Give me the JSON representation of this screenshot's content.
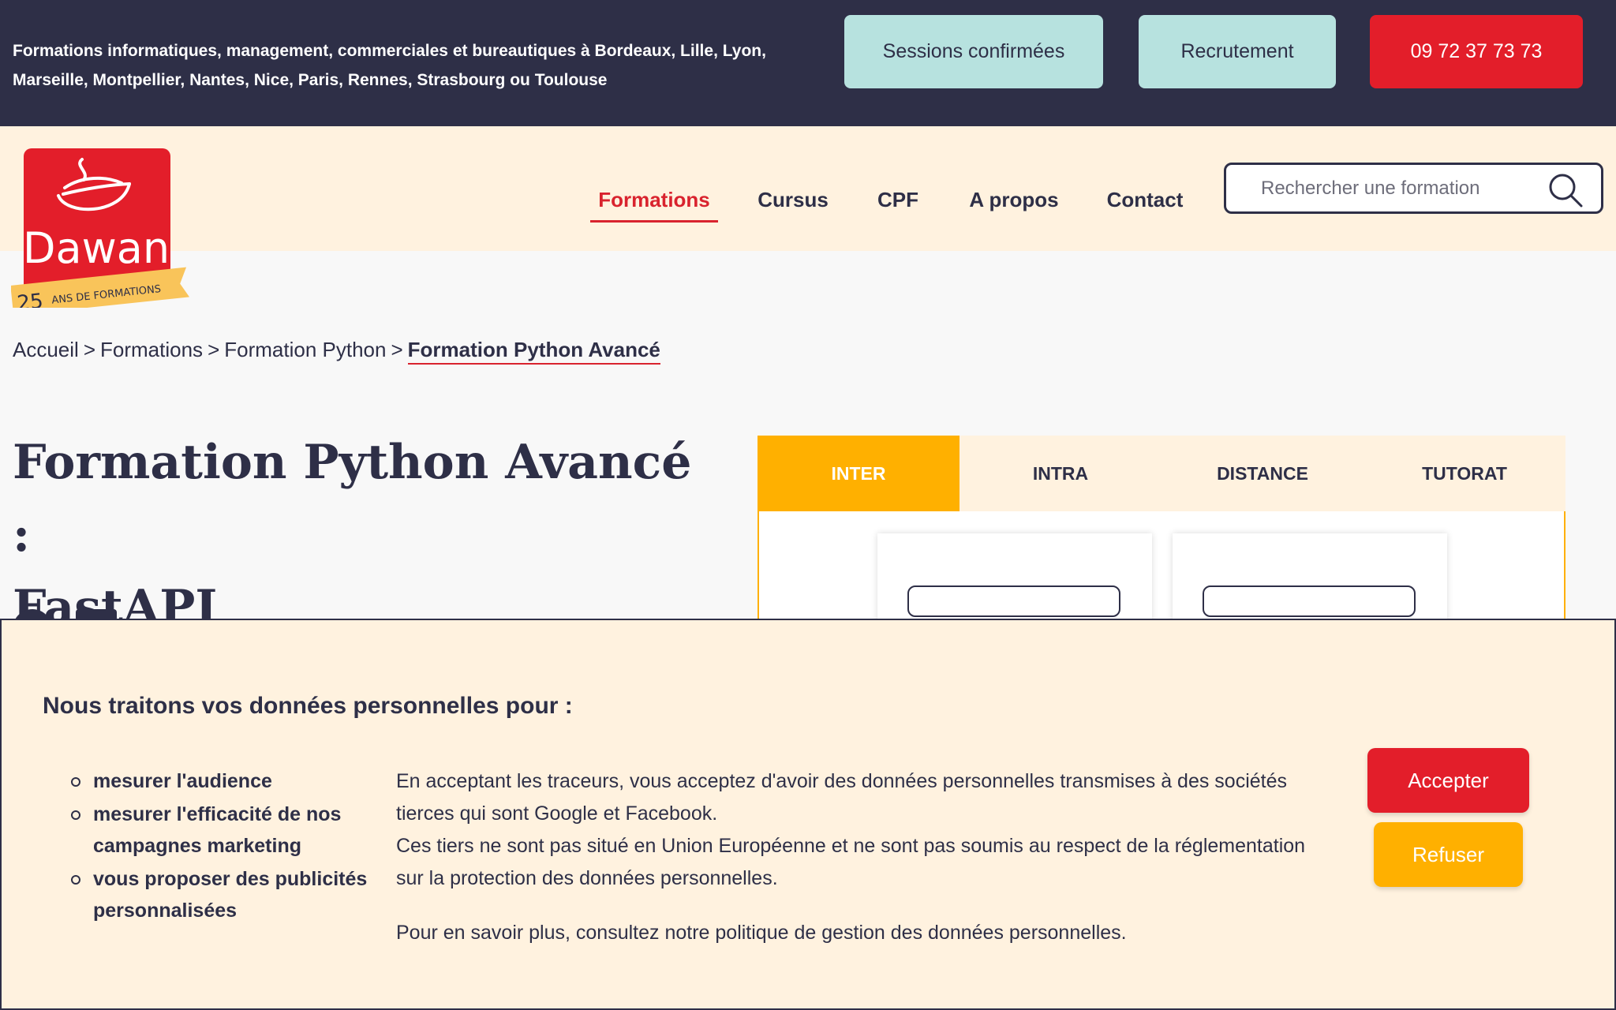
{
  "topbar": {
    "tagline": "Formations informatiques, management, commerciales et bureautiques à Bordeaux, Lille, Lyon, Marseille, Montpellier, Nantes, Nice, Paris, Rennes, Strasbourg ou Toulouse",
    "buttons": {
      "sessions": "Sessions confirmées",
      "recrutement": "Recrutement",
      "phone": "09 72 37 73 73"
    }
  },
  "logo": {
    "brand": "Dawan",
    "years": "25",
    "ribbon": "ANS DE FORMATIONS"
  },
  "nav": {
    "items": [
      "Formations",
      "Cursus",
      "CPF",
      "A propos",
      "Contact"
    ],
    "active": "Formations"
  },
  "search": {
    "placeholder": "Rechercher une formation"
  },
  "breadcrumb": {
    "items": [
      "Accueil",
      "Formations",
      "Formation Python"
    ],
    "current": "Formation Python Avancé",
    "separator": ">"
  },
  "page": {
    "title_line1": "Formation Python Avancé :",
    "title_line2": "FastAPI"
  },
  "tabs": {
    "items": [
      "INTER",
      "INTRA",
      "DISTANCE",
      "TUTORAT"
    ],
    "active": "INTER"
  },
  "cookie": {
    "title": "Nous traitons vos données personnelles pour :",
    "purposes": [
      "mesurer l'audience",
      "mesurer l'efficacité de nos campagnes marketing",
      "vous proposer des publicités personnalisées"
    ],
    "text1": "En acceptant les traceurs, vous acceptez d'avoir des données personnelles transmises à des sociétés tierces qui sont Google et Facebook.",
    "text2": "Ces tiers ne sont pas situé en Union Européenne et ne sont pas soumis au respect de la réglementation sur la protection des données personnelles.",
    "more": "Pour en savoir plus, consultez notre politique de gestion des données personnelles.",
    "accept": "Accepter",
    "refuse": "Refuser"
  },
  "colors": {
    "navy": "#2e2f47",
    "red": "#e31e2a",
    "yellow": "#ffb000",
    "mint": "#b7e2df",
    "cream": "#fff2df"
  }
}
